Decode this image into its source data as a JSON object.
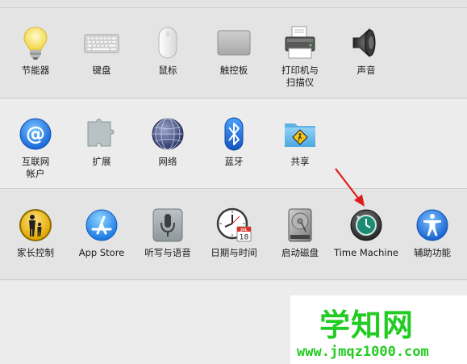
{
  "rows": [
    [
      {
        "name": "energy-saver-pref",
        "icon": "lightbulb-icon",
        "label": "节能器"
      },
      {
        "name": "keyboard-pref",
        "icon": "keyboard-icon",
        "label": "键盘"
      },
      {
        "name": "mouse-pref",
        "icon": "mouse-icon",
        "label": "鼠标"
      },
      {
        "name": "trackpad-pref",
        "icon": "trackpad-icon",
        "label": "触控板"
      },
      {
        "name": "printers-scanners-pref",
        "icon": "printer-icon",
        "label": "打印机与\n扫描仪"
      },
      {
        "name": "sound-pref",
        "icon": "speaker-icon",
        "label": "声音"
      }
    ],
    [
      {
        "name": "internet-accounts-pref",
        "icon": "at-sign-icon",
        "label": "互联网\n帐户"
      },
      {
        "name": "extensions-pref",
        "icon": "puzzle-icon",
        "label": "扩展"
      },
      {
        "name": "network-pref",
        "icon": "globe-icon",
        "label": "网络"
      },
      {
        "name": "bluetooth-pref",
        "icon": "bluetooth-icon",
        "label": "蓝牙"
      },
      {
        "name": "sharing-pref",
        "icon": "shared-folder-icon",
        "label": "共享"
      }
    ],
    [
      {
        "name": "parental-controls-pref",
        "icon": "parental-controls-icon",
        "label": "家长控制"
      },
      {
        "name": "app-store-pref",
        "icon": "app-store-icon",
        "label": "App Store"
      },
      {
        "name": "dictation-speech-pref",
        "icon": "microphone-icon",
        "label": "听写与语音"
      },
      {
        "name": "date-time-pref",
        "icon": "clock-calendar-icon",
        "label": "日期与时间",
        "calendar_day": "18",
        "calendar_month": "JUL"
      },
      {
        "name": "startup-disk-pref",
        "icon": "hard-disk-icon",
        "label": "启动磁盘"
      },
      {
        "name": "time-machine-pref",
        "icon": "time-machine-icon",
        "label": "Time Machine"
      },
      {
        "name": "accessibility-pref",
        "icon": "accessibility-icon",
        "label": "辅助功能"
      }
    ]
  ],
  "annotation": {
    "icon": "red-arrow-icon",
    "color": "#e01b1b",
    "target": "Time Machine"
  },
  "watermark": {
    "title": "学知网",
    "url": "www.jmqz1000.com",
    "color": "#22cc22"
  }
}
